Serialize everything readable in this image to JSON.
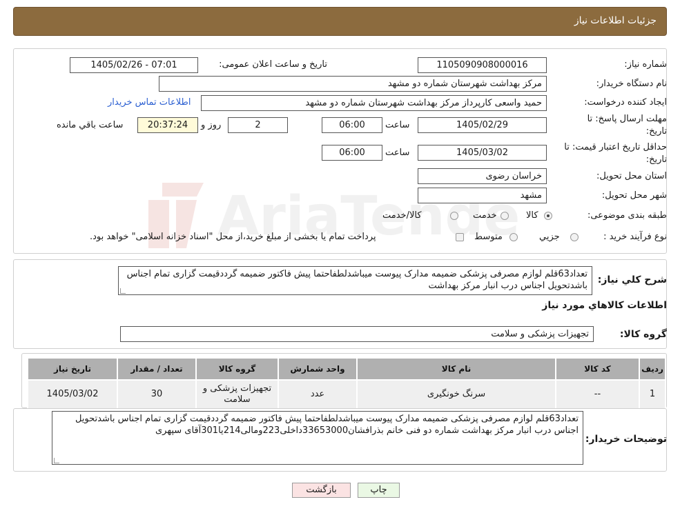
{
  "header": {
    "title": "جزئیات اطلاعات نیاز"
  },
  "fields": {
    "need_number": {
      "label": "شماره نیاز:",
      "value": "1105090908000016"
    },
    "announce_datetime": {
      "label": "تاریخ و ساعت اعلان عمومی:",
      "value": "1405/02/26 - 07:01"
    },
    "buyer_org": {
      "label": "نام دستگاه خریدار:",
      "value": "مرکز بهداشت شهرستان شماره دو مشهد"
    },
    "requester": {
      "label": "ایجاد کننده درخواست:",
      "value": "حمید واسعی کارپرداز مرکز بهداشت شهرستان شماره دو مشهد",
      "contact_link": "اطلاعات تماس خریدار"
    },
    "reply_deadline": {
      "label_line1": "مهلت ارسال پاسخ: تا",
      "label_line2": "تاریخ:",
      "date": "1405/02/29",
      "time_label": "ساعت",
      "time": "06:00",
      "days": "2",
      "days_label": "روز و",
      "remaining": "20:37:24",
      "remaining_label": "ساعت باقي مانده"
    },
    "price_validity": {
      "label_line1": "حداقل تاریخ اعتبار قیمت: تا",
      "label_line2": "تاریخ:",
      "date": "1405/03/02",
      "time_label": "ساعت",
      "time": "06:00"
    },
    "province": {
      "label": "استان محل تحویل:",
      "value": "خراسان رضوی"
    },
    "city": {
      "label": "شهر محل تحویل:",
      "value": "مشهد"
    },
    "category": {
      "label": "طبقه بندی موضوعی:",
      "options": [
        "کالا",
        "خدمت",
        "کالا/خدمت"
      ],
      "selected": "کالا"
    },
    "purchase_type": {
      "label": "نوع فرآیند خرید :",
      "options": [
        "جزیي",
        "متوسط"
      ],
      "note": "پرداخت تمام یا بخشی از مبلغ خرید،از محل \"اسناد خزانه اسلامی\" خواهد بود."
    }
  },
  "description": {
    "label": "شرح کلي نیاز:",
    "text": "تعداد63قلم لوازم مصرفی پزشکی ضمیمه مدارک پیوست میباشدلطفاحتما پیش فاکتور ضمیمه گرددقیمت گزاری تمام اجناس باشدتحویل اجناس درب انبار مرکز بهداشت"
  },
  "goods_info": {
    "title": "اطلاعات کالاهاي مورد نیاز",
    "group_label": "گروه کالا:",
    "group_value": "تجهیزات پزشکی و سلامت"
  },
  "table": {
    "headers": [
      "ردیف",
      "کد کالا",
      "نام کالا",
      "واحد شمارش",
      "گروه کالا",
      "تعداد / مقدار",
      "تاریخ نیاز"
    ],
    "rows": [
      [
        "1",
        "--",
        "سرنگ خونگیری",
        "عدد",
        "تجهیزات پزشکی و سلامت",
        "30",
        "1405/03/02"
      ]
    ]
  },
  "buyer_notes": {
    "label": "توضیحات خریدار:",
    "text": "تعداد63قلم لوازم مصرفی پزشکی ضمیمه مدارک پیوست میباشدلطفاحتما پیش فاکتور ضمیمه گرددقیمت گزاری تمام اجناس باشدتحویل اجناس درب انبار مرکز بهداشت شماره دو فنی خانم بذرافشان33653000داخلی223ومالی214یا301آقای سپهری"
  },
  "buttons": {
    "print": "چاپ",
    "back": "بازگشت"
  },
  "watermark": {
    "text": "AriaTender.neT"
  }
}
